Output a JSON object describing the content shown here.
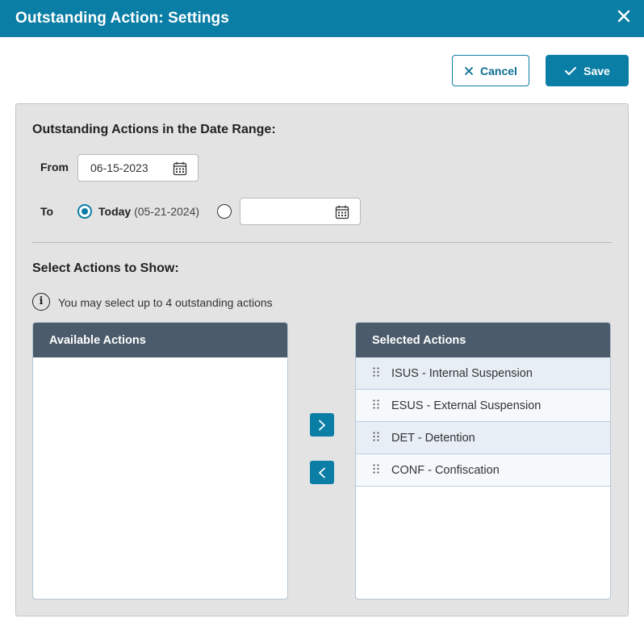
{
  "dialog": {
    "title": "Outstanding Action: Settings"
  },
  "toolbar": {
    "cancel_label": "Cancel",
    "save_label": "Save"
  },
  "date_range": {
    "heading": "Outstanding Actions in the Date Range:",
    "from_label": "From",
    "from_value": "06-15-2023",
    "to_label": "To",
    "today_label": "Today",
    "today_date": "(05-21-2024)",
    "to_option_selected": "today",
    "custom_to_value": ""
  },
  "actions": {
    "heading": "Select Actions to Show:",
    "info_text": "You may select up to 4 outstanding actions",
    "available_header": "Available Actions",
    "available_items": [],
    "selected_header": "Selected Actions",
    "selected_items": [
      "ISUS - Internal Suspension",
      "ESUS - External Suspension",
      "DET - Detention",
      "CONF - Confiscation"
    ]
  },
  "icons": {
    "close": "close-icon",
    "cancel": "x-icon",
    "save": "checkmark-icon",
    "calendar": "calendar-icon",
    "info": "info-icon",
    "grip": "drag-handle-icon",
    "move_right": "chevron-right-icon",
    "move_left": "chevron-left-icon"
  },
  "colors": {
    "primary": "#0b7ea5",
    "list_header": "#4b5b6b",
    "panel_bg": "#e3e3e3"
  }
}
